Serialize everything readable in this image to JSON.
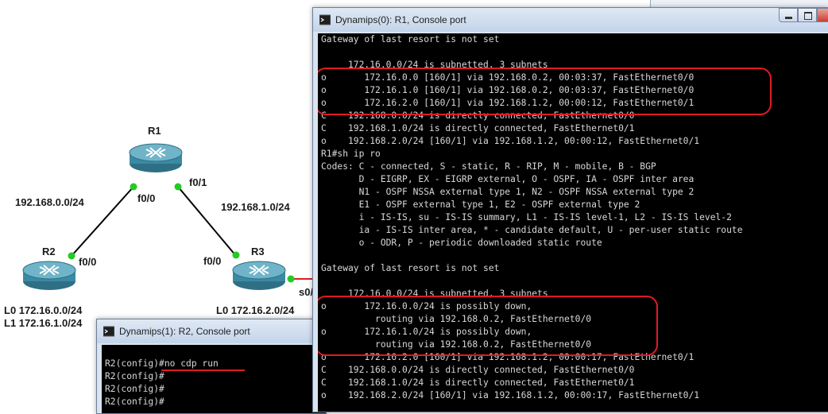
{
  "topology": {
    "routers": [
      {
        "name": "R1"
      },
      {
        "name": "R2"
      },
      {
        "name": "R3"
      }
    ],
    "networks": [
      "192.168.0.0/24",
      "192.168.1.0/24"
    ],
    "interfaces": {
      "r1_f00": "f0/0",
      "r1_f01": "f0/1",
      "r2_f00": "f0/0",
      "r3_f00": "f0/0",
      "r3_s0": "s0/"
    },
    "loopbacks": {
      "r2_l0": "L0 172.16.0.0/24",
      "r2_l1": "L1 172.16.1.0/24",
      "r3_l0": "L0 172.16.2.0/24"
    },
    "link_color": "#000000",
    "port_color": "#22cc22",
    "serial_link_color": "#e01b24"
  },
  "window_r1": {
    "title": "Dynamips(0): R1, Console port",
    "lines": [
      "Gateway of last resort is not set",
      "",
      "     172.16.0.0/24 is subnetted, 3 subnets",
      "o       172.16.0.0 [160/1] via 192.168.0.2, 00:03:37, FastEthernet0/0",
      "o       172.16.1.0 [160/1] via 192.168.0.2, 00:03:37, FastEthernet0/0",
      "o       172.16.2.0 [160/1] via 192.168.1.2, 00:00:12, FastEthernet0/1",
      "C    192.168.0.0/24 is directly connected, FastEthernet0/0",
      "C    192.168.1.0/24 is directly connected, FastEthernet0/1",
      "o    192.168.2.0/24 [160/1] via 192.168.1.2, 00:00:12, FastEthernet0/1",
      "R1#sh ip ro",
      "Codes: C - connected, S - static, R - RIP, M - mobile, B - BGP",
      "       D - EIGRP, EX - EIGRP external, O - OSPF, IA - OSPF inter area",
      "       N1 - OSPF NSSA external type 1, N2 - OSPF NSSA external type 2",
      "       E1 - OSPF external type 1, E2 - OSPF external type 2",
      "       i - IS-IS, su - IS-IS summary, L1 - IS-IS level-1, L2 - IS-IS level-2",
      "       ia - IS-IS inter area, * - candidate default, U - per-user static route",
      "       o - ODR, P - periodic downloaded static route",
      "",
      "Gateway of last resort is not set",
      "",
      "     172.16.0.0/24 is subnetted, 3 subnets",
      "o       172.16.0.0/24 is possibly down,",
      "          routing via 192.168.0.2, FastEthernet0/0",
      "o       172.16.1.0/24 is possibly down,",
      "          routing via 192.168.0.2, FastEthernet0/0",
      "o       172.16.2.0 [160/1] via 192.168.1.2, 00:00:17, FastEthernet0/1",
      "C    192.168.0.0/24 is directly connected, FastEthernet0/0",
      "C    192.168.1.0/24 is directly connected, FastEthernet0/1",
      "o    192.168.2.0/24 [160/1] via 192.168.1.2, 00:00:17, FastEthernet0/1"
    ]
  },
  "window_r2": {
    "title": "Dynamips(1): R2, Console port",
    "lines": [
      "R2(config)#no cdp run",
      "R2(config)#",
      "R2(config)#",
      "R2(config)#"
    ]
  },
  "highlight_color": "#e01b24"
}
